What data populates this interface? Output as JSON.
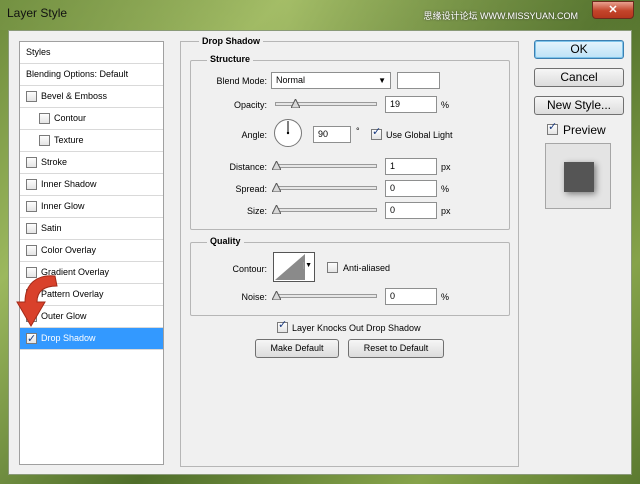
{
  "window": {
    "title": "Layer Style",
    "watermark": "思缘设计论坛 WWW.MISSYUAN.COM",
    "close_glyph": "✕"
  },
  "styles_list": {
    "header": "Styles",
    "blending": "Blending Options: Default",
    "items": [
      {
        "label": "Bevel & Emboss",
        "checked": false
      },
      {
        "label": "Contour",
        "checked": false
      },
      {
        "label": "Texture",
        "checked": false
      },
      {
        "label": "Stroke",
        "checked": false
      },
      {
        "label": "Inner Shadow",
        "checked": false
      },
      {
        "label": "Inner Glow",
        "checked": false
      },
      {
        "label": "Satin",
        "checked": false
      },
      {
        "label": "Color Overlay",
        "checked": false
      },
      {
        "label": "Gradient Overlay",
        "checked": false
      },
      {
        "label": "Pattern Overlay",
        "checked": false
      },
      {
        "label": "Outer Glow",
        "checked": false
      },
      {
        "label": "Drop Shadow",
        "checked": true
      }
    ]
  },
  "drop_shadow": {
    "title": "Drop Shadow",
    "structure": {
      "title": "Structure",
      "blend_mode_label": "Blend Mode:",
      "blend_mode_value": "Normal",
      "shadow_color": "#000000",
      "opacity_label": "Opacity:",
      "opacity_value": "19",
      "opacity_unit": "%",
      "opacity_fraction": 0.19,
      "angle_label": "Angle:",
      "angle_value": "90",
      "angle_unit": "°",
      "use_global_light_label": "Use Global Light",
      "use_global_light_checked": true,
      "distance_label": "Distance:",
      "distance_value": "1",
      "distance_unit": "px",
      "distance_fraction": 0.0,
      "spread_label": "Spread:",
      "spread_value": "0",
      "spread_unit": "%",
      "spread_fraction": 0.0,
      "size_label": "Size:",
      "size_value": "0",
      "size_unit": "px",
      "size_fraction": 0.0
    },
    "quality": {
      "title": "Quality",
      "contour_label": "Contour:",
      "anti_aliased_label": "Anti-aliased",
      "anti_aliased_checked": false,
      "noise_label": "Noise:",
      "noise_value": "0",
      "noise_unit": "%",
      "noise_fraction": 0.0
    },
    "knocks_out_label": "Layer Knocks Out Drop Shadow",
    "knocks_out_checked": true,
    "make_default_label": "Make Default",
    "reset_default_label": "Reset to Default"
  },
  "actions": {
    "ok_label": "OK",
    "cancel_label": "Cancel",
    "new_style_label": "New Style...",
    "preview_label": "Preview",
    "preview_checked": true
  },
  "colors": {
    "selection": "#3399ff",
    "arrow": "#d9412b"
  }
}
